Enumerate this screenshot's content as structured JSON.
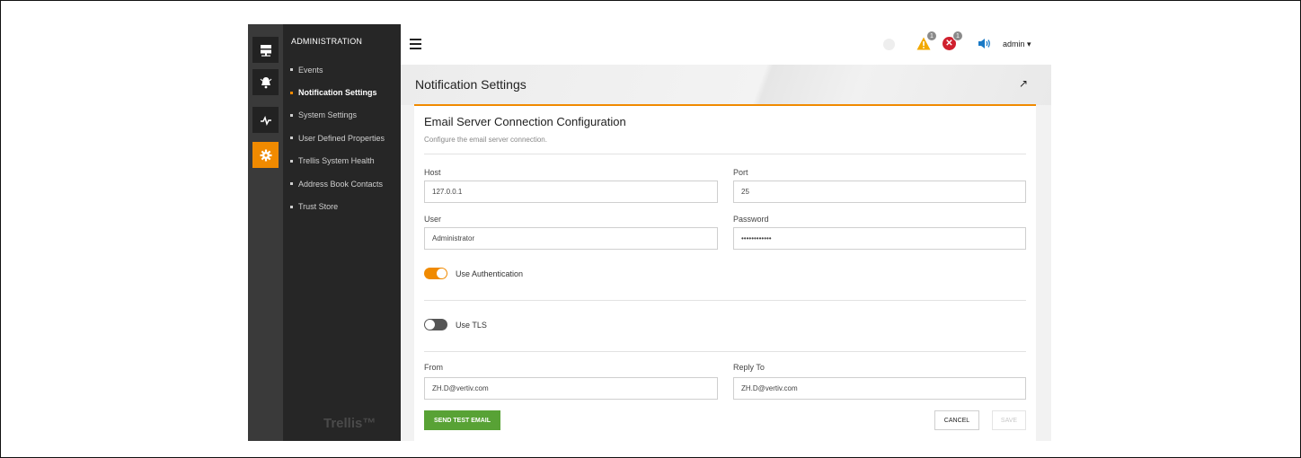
{
  "sidebar": {
    "title": "ADMINISTRATION",
    "items": [
      {
        "label": "Events",
        "active": false
      },
      {
        "label": "Notification Settings",
        "active": true
      },
      {
        "label": "System Settings",
        "active": false
      },
      {
        "label": "User Defined Properties",
        "active": false
      },
      {
        "label": "Trellis System Health",
        "active": false
      },
      {
        "label": "Address Book Contacts",
        "active": false
      },
      {
        "label": "Trust Store",
        "active": false
      }
    ],
    "brand": "Trellis™",
    "rail_icons": [
      "server-icon",
      "alarm-bell-icon",
      "pulse-icon",
      "gear-icon"
    ],
    "accent_color": "#f08a00"
  },
  "topbar": {
    "warning_count": "1",
    "error_count": "1",
    "user": "admin ▾"
  },
  "page": {
    "title": "Notification Settings",
    "expand_icon": "↗"
  },
  "card": {
    "title": "Email Server Connection Configuration",
    "description": "Configure the email server connection.",
    "host_label": "Host",
    "host_value": "127.0.0.1",
    "port_label": "Port",
    "port_value": "25",
    "user_label": "User",
    "user_value": "Administrator",
    "password_label": "Password",
    "password_value": "••••••••••••",
    "use_auth_label": "Use Authentication",
    "use_auth_on": true,
    "use_tls_label": "Use TLS",
    "use_tls_on": false,
    "from_label": "From",
    "from_value": "ZH.D@vertiv.com",
    "reply_to_label": "Reply To",
    "reply_to_value": "ZH.D@vertiv.com",
    "send_test_label": "SEND TEST EMAIL",
    "cancel_label": "CANCEL",
    "save_label": "SAVE"
  }
}
